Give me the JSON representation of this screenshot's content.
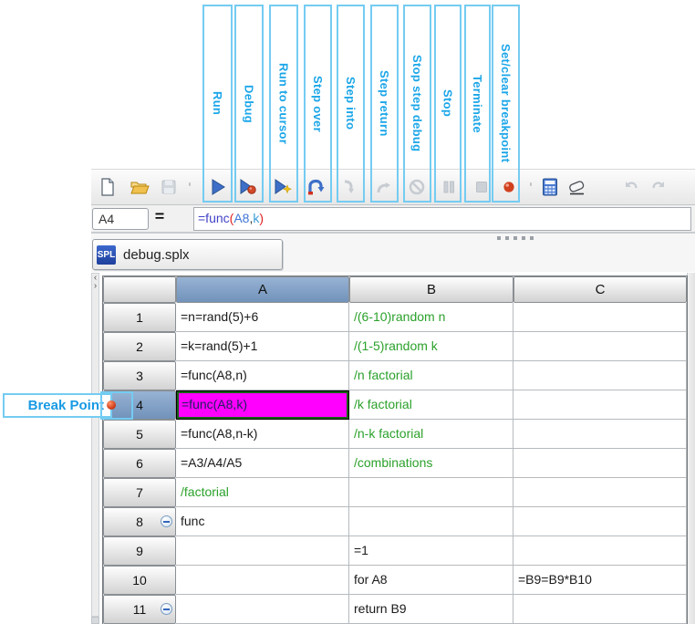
{
  "annotations": {
    "toolbar_labels": [
      {
        "label": "Run"
      },
      {
        "label": "Debug"
      },
      {
        "label": "Run to cursor"
      },
      {
        "label": "Step over"
      },
      {
        "label": "Step into"
      },
      {
        "label": "Step return"
      },
      {
        "label": "Stop step debug"
      },
      {
        "label": "Stop"
      },
      {
        "label": "Terminate"
      },
      {
        "label": "Set/clear breakpoint"
      }
    ],
    "breakpoint_callout": "Break Point",
    "annotation_text_color": "#1ba6e8",
    "annotation_border_color": "#74ccf2"
  },
  "toolbar": {
    "icons": [
      {
        "name": "new"
      },
      {
        "name": "open"
      },
      {
        "name": "save",
        "disabled": true
      },
      {
        "name": "run"
      },
      {
        "name": "debug"
      },
      {
        "name": "run-to-cursor"
      },
      {
        "name": "step-over"
      },
      {
        "name": "step-into",
        "disabled": true
      },
      {
        "name": "step-return",
        "disabled": true
      },
      {
        "name": "stop-step-debug",
        "disabled": true
      },
      {
        "name": "stop",
        "disabled": true
      },
      {
        "name": "terminate",
        "disabled": true
      },
      {
        "name": "set-clear-breakpoint"
      },
      {
        "name": "calculator"
      },
      {
        "name": "eraser"
      },
      {
        "name": "undo",
        "disabled": true
      },
      {
        "name": "redo",
        "disabled": true
      }
    ]
  },
  "formula_bar": {
    "cell_ref": "A4",
    "equals_sign": "=",
    "formula": "=func(A8,k)",
    "parts": [
      {
        "text": "=func",
        "color": "#4343c8"
      },
      {
        "text": "(",
        "color": "#e02020"
      },
      {
        "text": "A8",
        "color": "#4076d6"
      },
      {
        "text": ",",
        "color": "#333333"
      },
      {
        "text": "k",
        "color": "#3b9bd8"
      },
      {
        "text": ")",
        "color": "#e02020"
      }
    ]
  },
  "tab": {
    "logo": "SPL",
    "title": "debug.splx"
  },
  "grid": {
    "column_headers": [
      "A",
      "B",
      "C"
    ],
    "selected_cell": "A4",
    "selected_cell_bg": "#ff00ff",
    "selected_header_bg": "#7c9cc4",
    "comment_color": "#2ba12b",
    "breakpoint_row": "4",
    "rows": [
      {
        "num": "1",
        "a": "=n=rand(5)+6",
        "b": "/(6-10)random n",
        "c": ""
      },
      {
        "num": "2",
        "a": "=k=rand(5)+1",
        "b": "/(1-5)random k",
        "c": ""
      },
      {
        "num": "3",
        "a": "=func(A8,n)",
        "b": "/n factorial",
        "c": ""
      },
      {
        "num": "4",
        "a": "=func(A8,k)",
        "b": "/k factorial",
        "c": ""
      },
      {
        "num": "5",
        "a": "=func(A8,n-k)",
        "b": "/n-k factorial",
        "c": ""
      },
      {
        "num": "6",
        "a": "=A3/A4/A5",
        "b": "/combinations",
        "c": ""
      },
      {
        "num": "7",
        "a": "/factorial",
        "b": "",
        "c": ""
      },
      {
        "num": "8",
        "a": "func",
        "b": "",
        "c": ""
      },
      {
        "num": "9",
        "a": "",
        "b": "=1",
        "c": ""
      },
      {
        "num": "10",
        "a": "",
        "b": "for A8",
        "c": "=B9=B9*B10"
      },
      {
        "num": "11",
        "a": "",
        "b": "return B9",
        "c": ""
      }
    ]
  }
}
